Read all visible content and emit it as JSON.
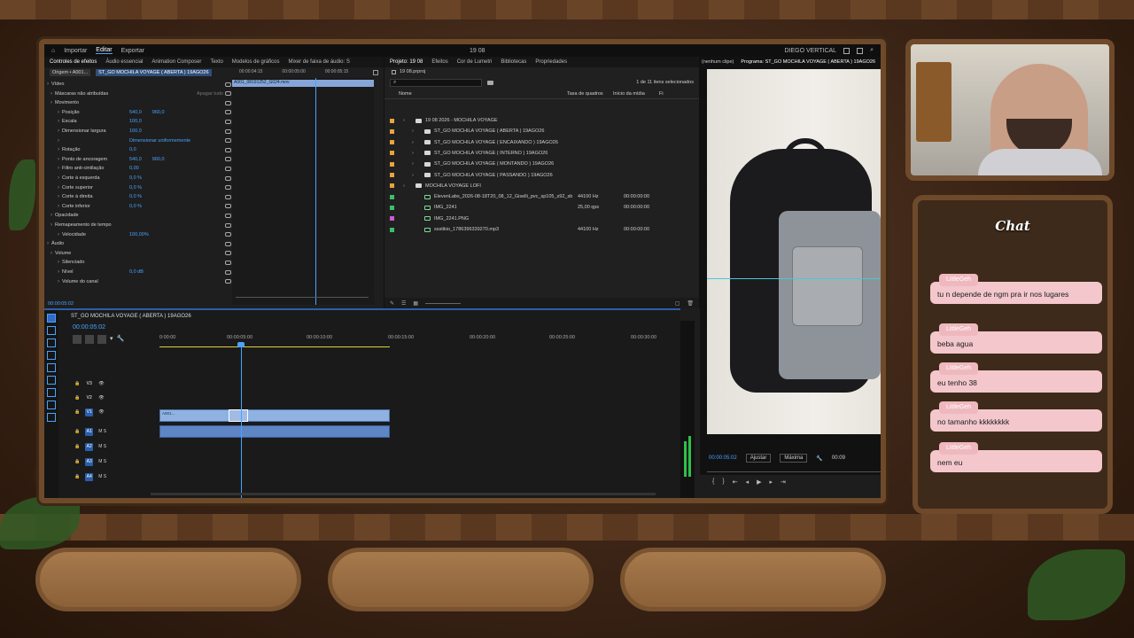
{
  "app": {
    "menu": [
      "Importar",
      "Editar",
      "Exportar"
    ],
    "active_menu": "Editar",
    "project_title": "19 08",
    "workspace": "DIEGO VERTICAL"
  },
  "effect_controls": {
    "tabs": [
      "Controles de efeitos",
      "Áudio essencial",
      "Animation Composer",
      "Texto",
      "Modelos de gráficos",
      "Mixer de faixa de áudio: S"
    ],
    "source": "Origem • A001...",
    "sequence": "ST_GO MOCHILA VOYAGE ( ABERTA ) 19AGO26",
    "clip_name": "A001_08191252_G024.mov",
    "times": [
      "00:00:04:15",
      "00:00:05:00",
      "00:00:05:15"
    ],
    "rows": [
      {
        "label": "Vídeo"
      },
      {
        "label": "Máscaras não atribuídas",
        "value": "Apagar tudo"
      },
      {
        "label": "Movimento"
      },
      {
        "label": "Posição",
        "value": "540,0",
        "value2": "960,0"
      },
      {
        "label": "Escala",
        "value": "100,0"
      },
      {
        "label": "Dimensionar largura",
        "value": "100,0"
      },
      {
        "label": "",
        "value": "Dimensionar uniformemente"
      },
      {
        "label": "Rotação",
        "value": "0,0"
      },
      {
        "label": "Ponto de ancoragem",
        "value": "540,0",
        "value2": "960,0"
      },
      {
        "label": "Filtro anti-cintilação",
        "value": "0,00"
      },
      {
        "label": "Corte à esquerda",
        "value": "0,0 %"
      },
      {
        "label": "Corte superior",
        "value": "0,0 %"
      },
      {
        "label": "Corte à direita",
        "value": "0,0 %"
      },
      {
        "label": "Corte inferior",
        "value": "0,0 %"
      },
      {
        "label": "Opacidade"
      },
      {
        "label": "Remapeamento de tempo"
      },
      {
        "label": "Velocidade",
        "value": "100,00%"
      },
      {
        "label": "Áudio"
      },
      {
        "label": "Volume"
      },
      {
        "label": "Silenciado"
      },
      {
        "label": "Nível",
        "value": "0,0 dB"
      },
      {
        "label": "Volume do canal"
      }
    ],
    "timecode": "00:00:05:02"
  },
  "project": {
    "tabs": [
      "Projeto: 19 08",
      "Efeitos",
      "Cor de Lumetri",
      "Bibliotecas",
      "Propriedades"
    ],
    "file": "19 08.prproj",
    "count": "1 de 11 itens selecionados",
    "columns": [
      "Nome",
      "Taxa de quadros",
      "Início da mídia",
      "Fi"
    ],
    "items": [
      {
        "name": "19 08 2026 - MOCHILA VOYAGE",
        "color": "#e8a33c",
        "indent": 0,
        "kind": "folder"
      },
      {
        "name": "ST_GO MOCHILA VOYAGE ( ABERTA ) 19AGO26",
        "color": "#e8a33c",
        "indent": 1,
        "kind": "folder"
      },
      {
        "name": "ST_GO MOCHILA VOYAGE ( ENCAIXANDO ) 19AGO26",
        "color": "#e8a33c",
        "indent": 1,
        "kind": "folder"
      },
      {
        "name": "ST_GO MOCHILA VOYAGE ( INTERNO ) 19AGO26",
        "color": "#e8a33c",
        "indent": 1,
        "kind": "folder"
      },
      {
        "name": "ST_GO MOCHILA VOYAGE ( MONTANDO ) 19AGO26",
        "color": "#e8a33c",
        "indent": 1,
        "kind": "folder"
      },
      {
        "name": "ST_GO MOCHILA VOYAGE ( PASSANDO ) 19AGO26",
        "color": "#e8a33c",
        "indent": 1,
        "kind": "folder"
      },
      {
        "name": "MOCHILA VOYAGE LOFI",
        "color": "#e8a33c",
        "indent": 0,
        "kind": "folder"
      },
      {
        "name": "ElevenLabs_2026-08-18T20_08_12_Giselli_pvc_sp105_s92_sb7",
        "color": "#3cbf6a",
        "indent": 1,
        "kind": "audio",
        "rate": "44100 Hz",
        "start": "00:00:00:00"
      },
      {
        "name": "IMG_2241",
        "color": "#3cbf6a",
        "indent": 1,
        "kind": "video",
        "rate": "25,00 qps",
        "start": "00:00:00:00"
      },
      {
        "name": "IMG_2241.PNG",
        "color": "#c85cd6",
        "indent": 1,
        "kind": "image"
      },
      {
        "name": "ssstikio_1786396339270.mp3",
        "color": "#3cbf6a",
        "indent": 1,
        "kind": "audio",
        "rate": "44100 Hz",
        "start": "00:00:00:00"
      }
    ]
  },
  "program": {
    "source_label": "(nenhum clipe)",
    "title": "Programa: ST_GO MOCHILA VOYAGE ( ABERTA ) 19AGO26",
    "timecode": "00:00:05:02",
    "fit": "Ajustar",
    "quality": "Máxima",
    "end_time": "00:09"
  },
  "timeline": {
    "sequence": "ST_GO MOCHILA VOYAGE ( ABERTA ) 19AGO26",
    "timecode": "00:00:05:02",
    "ruler": [
      "0:00:00",
      "00:00:05:00",
      "00:00:10:00",
      "00:00:15:00",
      "00:00:20:00",
      "00:00:25:00",
      "00:00:30:00"
    ],
    "video_tracks": [
      "V3",
      "V2",
      "V1"
    ],
    "audio_tracks": [
      "A1",
      "A2",
      "A3",
      "A4"
    ],
    "clip_labels": [
      "A001...",
      "A001...",
      "A001..."
    ]
  },
  "chat": {
    "title": "Chat",
    "messages": [
      {
        "user": "LittleGeh",
        "text": "tu n depende de ngm pra ir nos lugares"
      },
      {
        "user": "LittleGeh",
        "text": "beba agua"
      },
      {
        "user": "LittleGeh",
        "text": "eu tenho 38"
      },
      {
        "user": "LittleGeh",
        "text": "no tamanho kkkkkkkk"
      },
      {
        "user": "LittleGeh",
        "text": "nem eu"
      }
    ]
  }
}
